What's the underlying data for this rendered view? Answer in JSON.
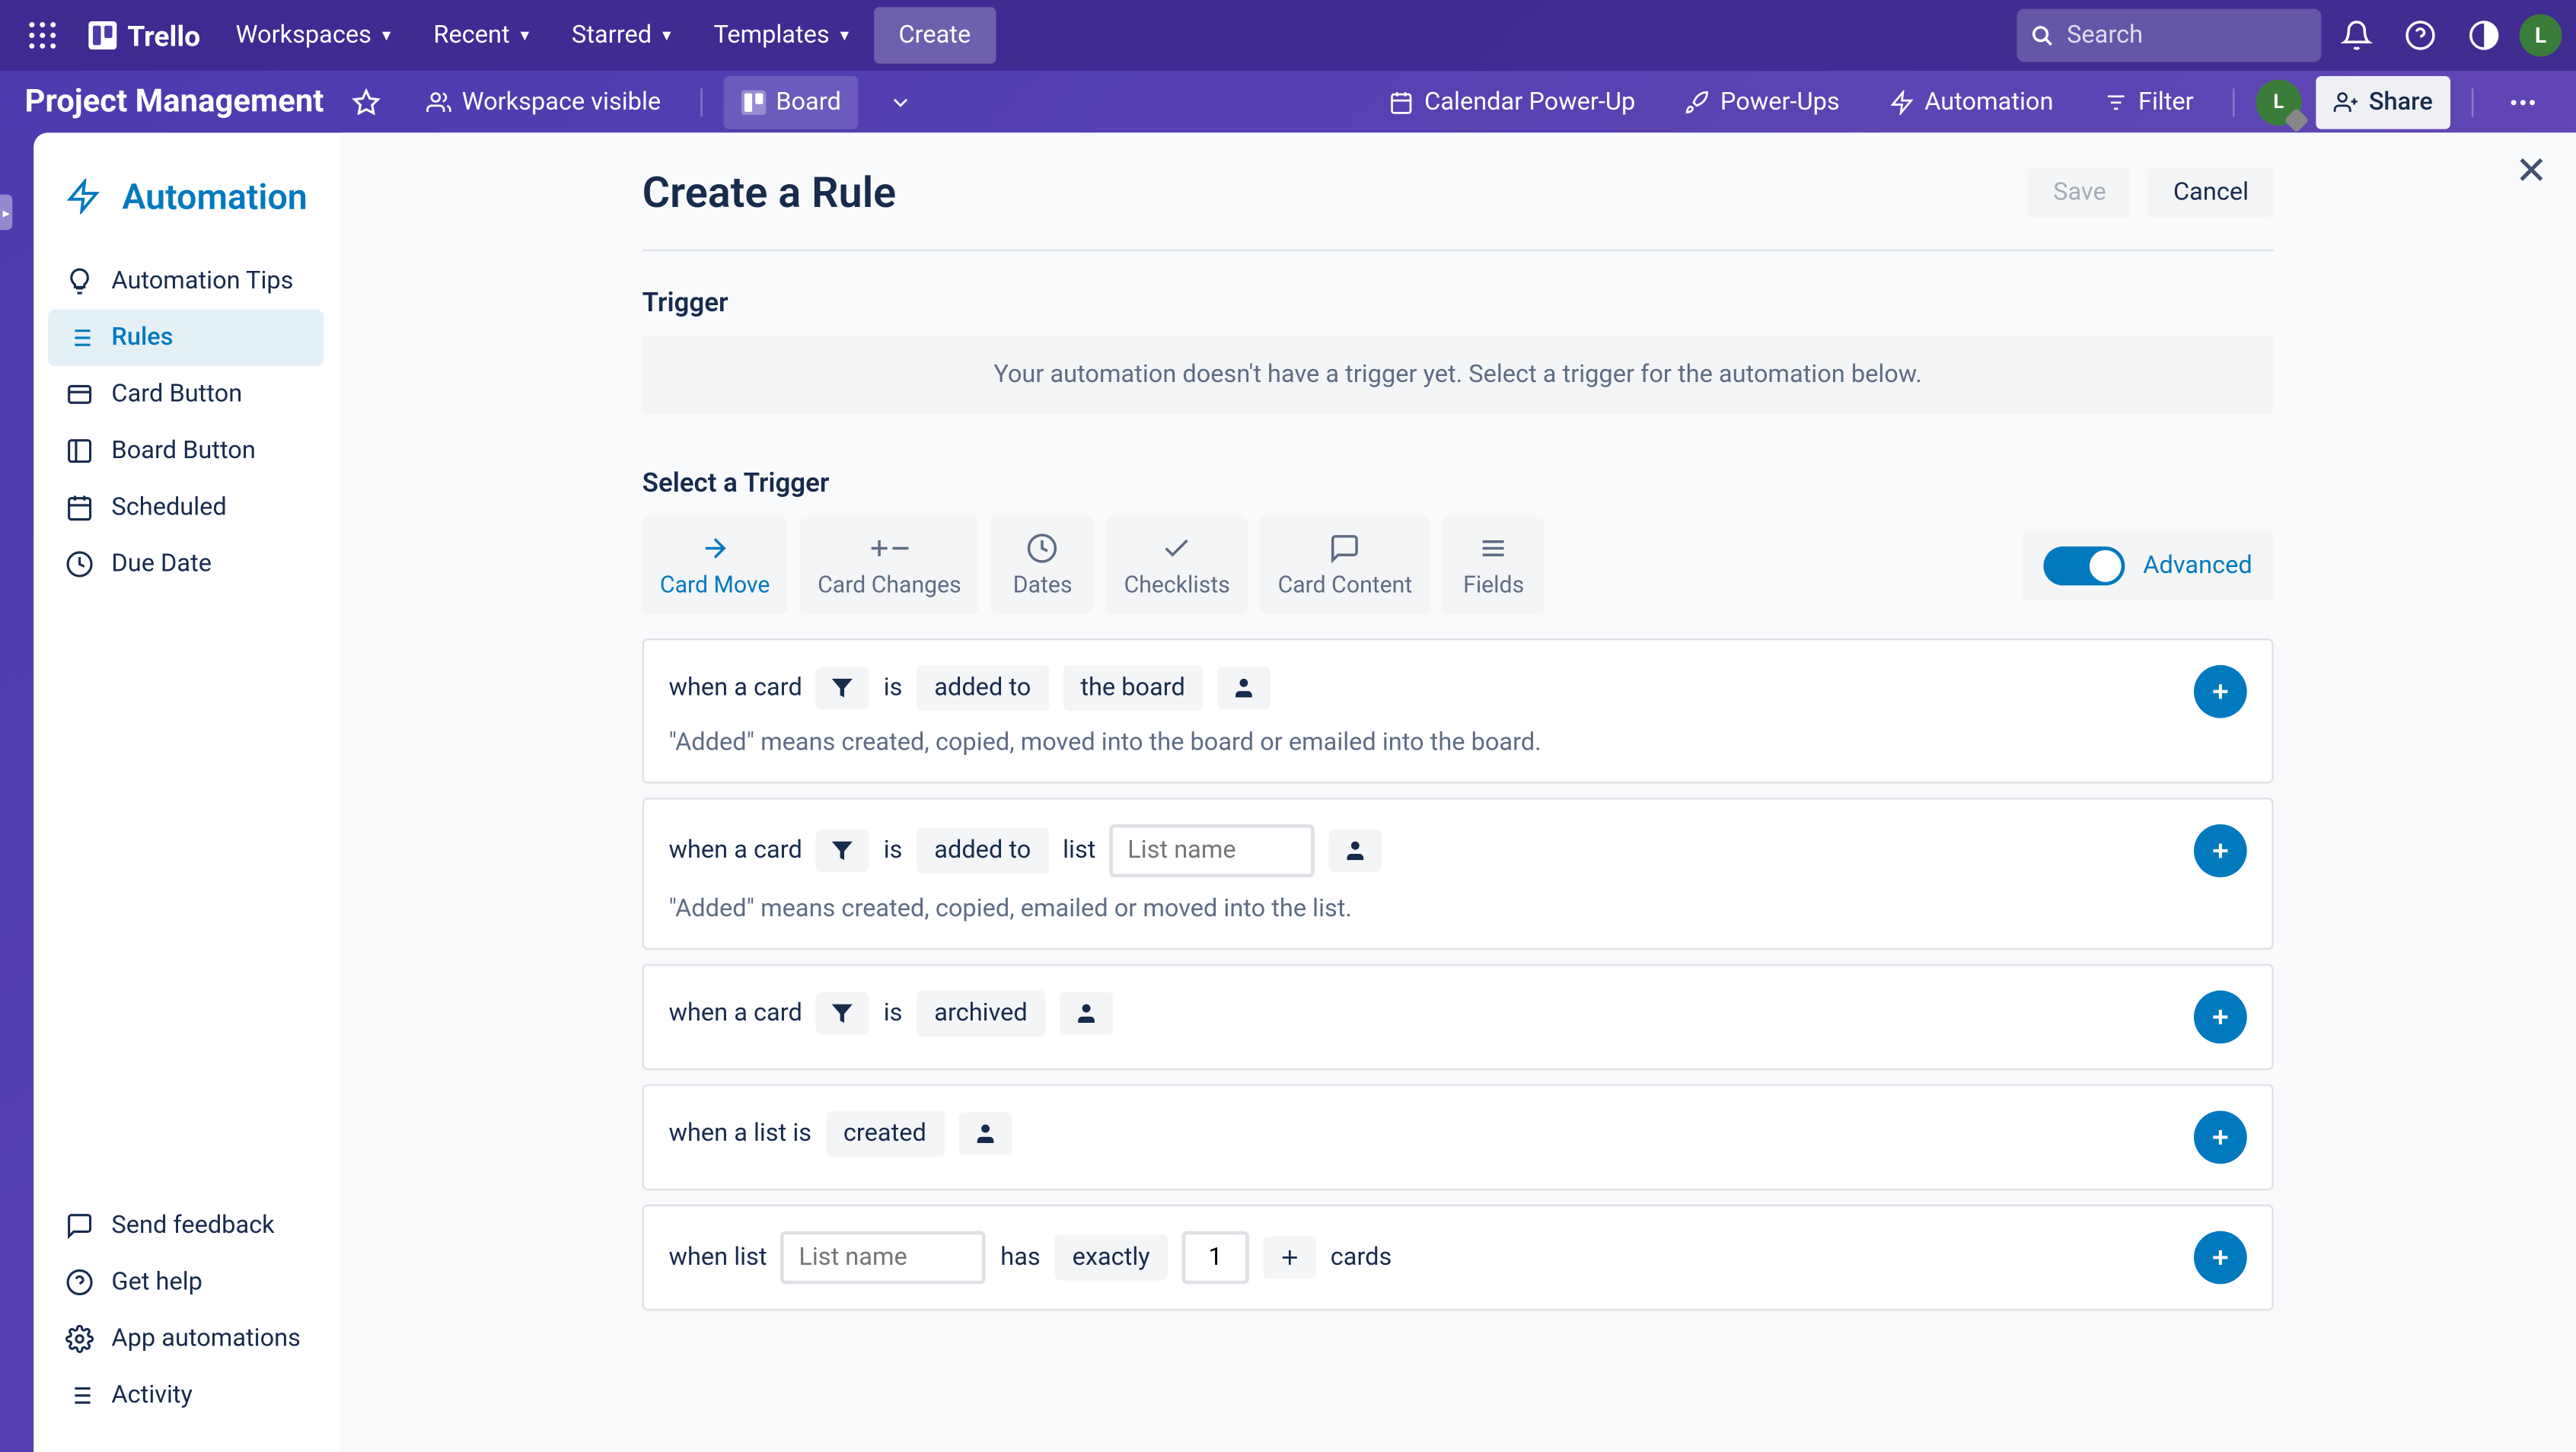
{
  "header": {
    "logo": "Trello",
    "nav": {
      "workspaces": "Workspaces",
      "recent": "Recent",
      "starred": "Starred",
      "templates": "Templates",
      "create": "Create"
    },
    "search_placeholder": "Search",
    "avatar_initial": "L"
  },
  "board": {
    "title": "Project Management",
    "workspace_visible": "Workspace visible",
    "board_btn": "Board",
    "calendar": "Calendar Power-Up",
    "powerups": "Power-Ups",
    "automation": "Automation",
    "filter": "Filter",
    "share": "Share",
    "avatar_initial": "L"
  },
  "sidebar": {
    "title": "Automation",
    "items": [
      "Automation Tips",
      "Rules",
      "Card Button",
      "Board Button",
      "Scheduled",
      "Due Date"
    ],
    "bottom": [
      "Send feedback",
      "Get help",
      "App automations",
      "Activity"
    ]
  },
  "page": {
    "title": "Create a Rule",
    "save": "Save",
    "cancel": "Cancel",
    "trigger_label": "Trigger",
    "trigger_placeholder": "Your automation doesn't have a trigger yet. Select a trigger for the automation below.",
    "select_trigger": "Select a Trigger",
    "tabs": [
      "Card Move",
      "Card Changes",
      "Dates",
      "Checklists",
      "Card Content",
      "Fields"
    ],
    "advanced": "Advanced",
    "rules": {
      "r1": {
        "prefix": "when a card",
        "is": "is",
        "action": "added to",
        "target": "the board",
        "hint": "\"Added\" means created, copied, moved into the board or emailed into the board."
      },
      "r2": {
        "prefix": "when a card",
        "is": "is",
        "action": "added to",
        "list": "list",
        "placeholder": "List name",
        "hint": "\"Added\" means created, copied, emailed or moved into the list."
      },
      "r3": {
        "prefix": "when a card",
        "is": "is",
        "action": "archived"
      },
      "r4": {
        "prefix": "when a list is",
        "action": "created"
      },
      "r5": {
        "prefix": "when list",
        "placeholder": "List name",
        "has": "has",
        "exactly": "exactly",
        "value": "1",
        "cards": "cards"
      }
    }
  }
}
